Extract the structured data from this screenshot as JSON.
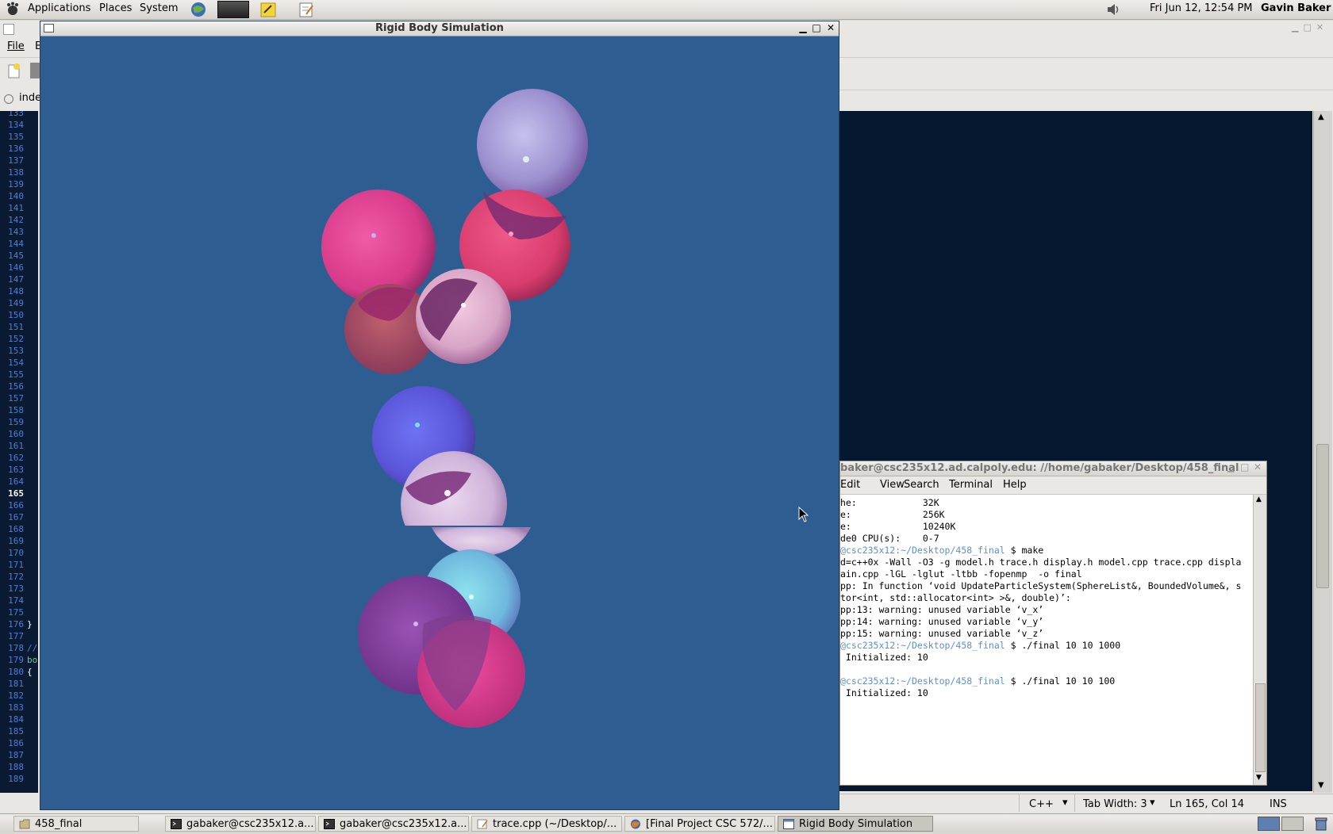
{
  "top_panel": {
    "menus": [
      "Applications",
      "Places",
      "System"
    ],
    "clock": "Fri Jun 12, 12:54 PM",
    "user": "Gavin Baker"
  },
  "editor": {
    "menu_file": "File",
    "menu_edit_partial": "E",
    "tab_partial": "inde",
    "line_numbers": [
      "133",
      "134",
      "135",
      "136",
      "137",
      "138",
      "139",
      "140",
      "141",
      "142",
      "143",
      "144",
      "145",
      "146",
      "147",
      "148",
      "149",
      "150",
      "151",
      "152",
      "153",
      "154",
      "155",
      "156",
      "157",
      "158",
      "159",
      "160",
      "161",
      "162",
      "163",
      "164",
      "165",
      "166",
      "167",
      "168",
      "169",
      "170",
      "171",
      "172",
      "173",
      "174",
      "175",
      "176",
      "177",
      "178",
      "179",
      "180",
      "181",
      "182",
      "183",
      "184",
      "185",
      "186",
      "187",
      "188",
      "189"
    ],
    "current_line": "165",
    "code_176": "}",
    "code_178": "//",
    "code_179": "boo",
    "code_180": "{",
    "status": {
      "language": "C++",
      "tab_width": "Tab Width: 3",
      "position": "Ln 165, Col 14",
      "mode": "INS"
    }
  },
  "sim_window": {
    "title": "Rigid Body Simulation",
    "background": "#2d5d91"
  },
  "terminal": {
    "title": "baker@csc235x12.ad.calpoly.edu: //home/gabaker/Desktop/458_final",
    "menus": [
      "Edit",
      "View",
      "Search",
      "Terminal",
      "Help"
    ],
    "lines": [
      {
        "pre": "he:",
        "rest": "            32K"
      },
      {
        "pre": "e:",
        "rest": "             256K"
      },
      {
        "pre": "e:",
        "rest": "             10240K"
      },
      {
        "pre": "de0 CPU(s):",
        "rest": "    0-7"
      },
      {
        "prompt": "@csc235x12:~/Desktop/458_final",
        "rest": " $ make"
      },
      {
        "pre": "d=c++0x -Wall -O3 -g model.h trace.h display.h model.cpp trace.cpp displa",
        "rest": ""
      },
      {
        "pre": "ain.cpp -lGL -lglut -ltbb -fopenmp  -o final",
        "rest": ""
      },
      {
        "pre": "pp: In function ‘void UpdateParticleSystem(SphereList&, BoundedVolume&, s",
        "rest": ""
      },
      {
        "pre": "tor<int, std::allocator<int> >&, double)’:",
        "rest": ""
      },
      {
        "pre": "pp:13: warning: unused variable ‘v_x’",
        "rest": ""
      },
      {
        "pre": "pp:14: warning: unused variable ‘v_y’",
        "rest": ""
      },
      {
        "pre": "pp:15: warning: unused variable ‘v_z’",
        "rest": ""
      },
      {
        "prompt": "@csc235x12:~/Desktop/458_final",
        "rest": " $ ./final 10 10 1000"
      },
      {
        "pre": " Initialized: 10",
        "rest": ""
      },
      {
        "pre": "",
        "rest": ""
      },
      {
        "prompt": "@csc235x12:~/Desktop/458_final",
        "rest": " $ ./final 10 10 100"
      },
      {
        "pre": " Initialized: 10",
        "rest": ""
      },
      {
        "pre": "",
        "rest": ""
      },
      {
        "pre": "",
        "rest": ""
      },
      {
        "pre": "",
        "rest": ""
      },
      {
        "pre": "",
        "rest": ""
      },
      {
        "pre": "",
        "rest": ""
      },
      {
        "pre": "",
        "rest": ""
      }
    ]
  },
  "taskbar": {
    "items": [
      {
        "label": "458_final",
        "icon": "folder-icon"
      },
      {
        "label": "gabaker@csc235x12.a...",
        "icon": "terminal-icon"
      },
      {
        "label": "gabaker@csc235x12.a...",
        "icon": "terminal-icon"
      },
      {
        "label": "trace.cpp (~/Desktop/...",
        "icon": "text-editor-icon"
      },
      {
        "label": "[Final Project CSC 572/...",
        "icon": "firefox-icon"
      },
      {
        "label": "Rigid Body Simulation",
        "icon": "window-icon"
      }
    ]
  }
}
